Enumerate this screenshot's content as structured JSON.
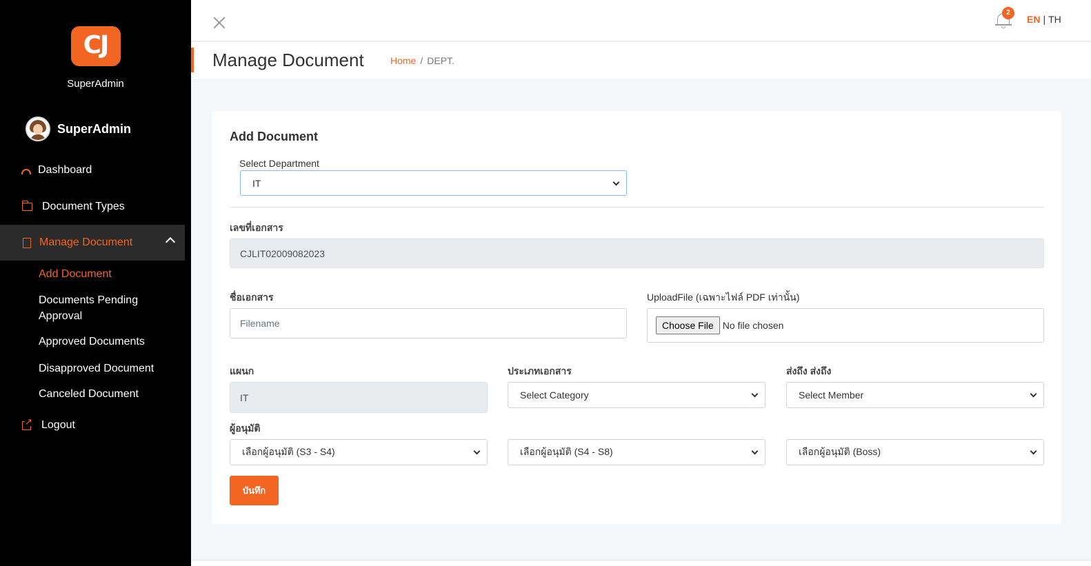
{
  "brand": {
    "logo_text": "CJ",
    "subtitle": "SuperAdmin",
    "accent": "#f26522"
  },
  "user": {
    "name": "SuperAdmin"
  },
  "nav": {
    "dashboard": "Dashboard",
    "document_types": "Document Types",
    "manage_document": "Manage Document",
    "logout": "Logout",
    "sub": {
      "add_document": "Add Document",
      "pending_approval": "Documents Pending Approval",
      "approved": "Approved Documents",
      "disapproved": "Disapproved Document",
      "canceled": "Canceled Document"
    }
  },
  "topbar": {
    "notification_count": "2",
    "lang_en": "EN",
    "lang_sep": "|",
    "lang_th": "TH"
  },
  "header": {
    "title": "Manage Document",
    "breadcrumb_home": "Home",
    "breadcrumb_sep": "/",
    "breadcrumb_current": "DEPT."
  },
  "form": {
    "title": "Add Document",
    "department_label": "Select Department",
    "department_value": "IT",
    "doc_number_label": "เลขที่เอกสาร",
    "doc_number_value": "CJLIT02009082023",
    "doc_name_label": "ชื่อเอกสาร",
    "doc_name_placeholder": "Filename",
    "upload_label": "UploadFile (เฉพาะไฟล์ PDF เท่านั้น)",
    "choose_file": "Choose File",
    "no_file": "No file chosen",
    "section_label": "แผนก",
    "section_value": "IT",
    "doc_type_label": "ประเภทเอกสาร",
    "doc_type_value": "Select Category",
    "send_to_label": "ส่งถึง ส่งถึง",
    "send_to_value": "Select Member",
    "approver_label": "ผู้อนุมัติ",
    "approver1_value": "เลือกผู้อนุมัติ (S3 - S4)",
    "approver2_value": "เลือกผู้อนุมัติ (S4 - S8)",
    "approver3_value": "เลือกผู้อนุมัติ (Boss)",
    "save_label": "บันทึก"
  }
}
